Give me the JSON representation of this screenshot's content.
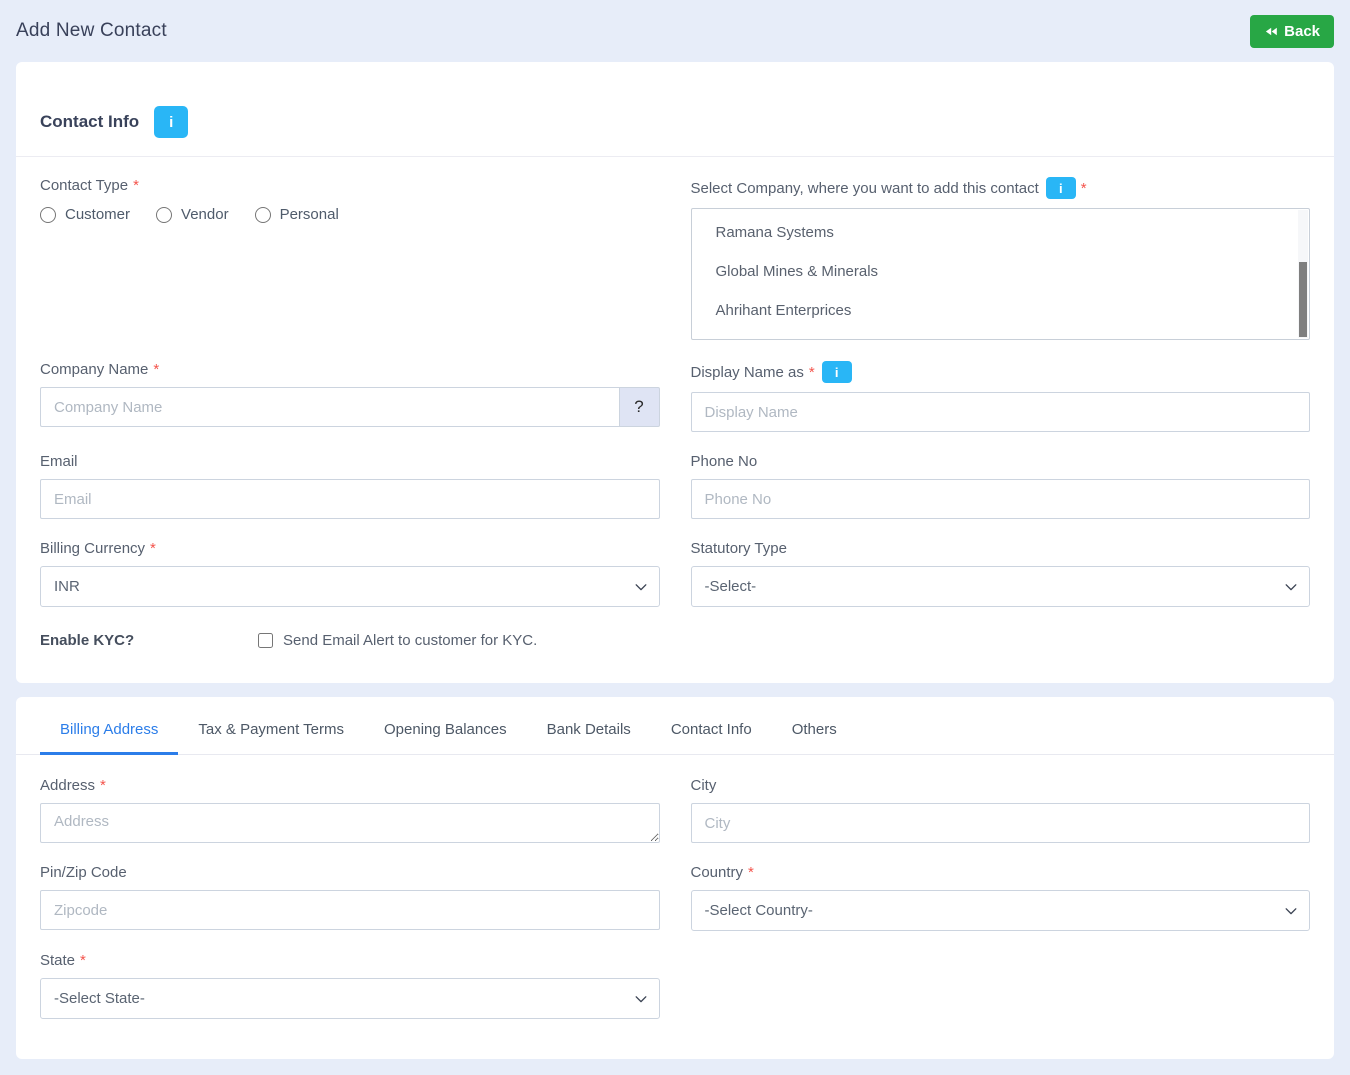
{
  "colors": {
    "page_background": "#e7edf9",
    "card_background": "#ffffff",
    "accent_tab_blue": "#2b7de9",
    "info_badge_blue": "#29b6f6",
    "back_button_green": "#28a745",
    "required_red": "#f4544c"
  },
  "header": {
    "title": "Add New Contact",
    "back_button": {
      "label": "Back"
    }
  },
  "contact_info": {
    "section_title": "Contact Info",
    "info_badge": "i",
    "contact_type": {
      "label": "Contact Type",
      "required_mark": "*",
      "options": [
        "Customer",
        "Vendor",
        "Personal"
      ]
    },
    "select_company": {
      "label": "Select Company, where you want to add this contact",
      "info_badge": "i",
      "required_mark": "*",
      "options": [
        "Ramana Systems",
        "Global Mines & Minerals",
        "Ahrihant Enterprices"
      ]
    },
    "company_name": {
      "label": "Company Name",
      "required_mark": "*",
      "placeholder": "Company Name",
      "help_button": "?"
    },
    "display_name": {
      "label": "Display Name as",
      "required_mark": "*",
      "info_badge": "i",
      "placeholder": "Display Name"
    },
    "email": {
      "label": "Email",
      "placeholder": "Email"
    },
    "phone": {
      "label": "Phone No",
      "placeholder": "Phone No"
    },
    "billing_currency": {
      "label": "Billing Currency",
      "required_mark": "*",
      "value": "INR"
    },
    "statutory_type": {
      "label": "Statutory Type",
      "value": "-Select-"
    },
    "kyc": {
      "label": "Enable KYC?",
      "checkbox_label": "Send Email Alert to customer for KYC."
    }
  },
  "address_section": {
    "active_tab": "Billing Address",
    "tabs": [
      {
        "label": "Billing Address"
      },
      {
        "label": "Tax & Payment Terms"
      },
      {
        "label": "Opening Balances"
      },
      {
        "label": "Bank Details"
      },
      {
        "label": "Contact Info"
      },
      {
        "label": "Others"
      }
    ],
    "address": {
      "label": "Address",
      "required_mark": "*",
      "placeholder": "Address"
    },
    "city": {
      "label": "City",
      "placeholder": "City"
    },
    "pin_zip": {
      "label": "Pin/Zip Code",
      "placeholder": "Zipcode"
    },
    "country": {
      "label": "Country",
      "required_mark": "*",
      "value": "-Select Country-"
    },
    "state": {
      "label": "State",
      "required_mark": "*",
      "value": "-Select State-"
    }
  }
}
